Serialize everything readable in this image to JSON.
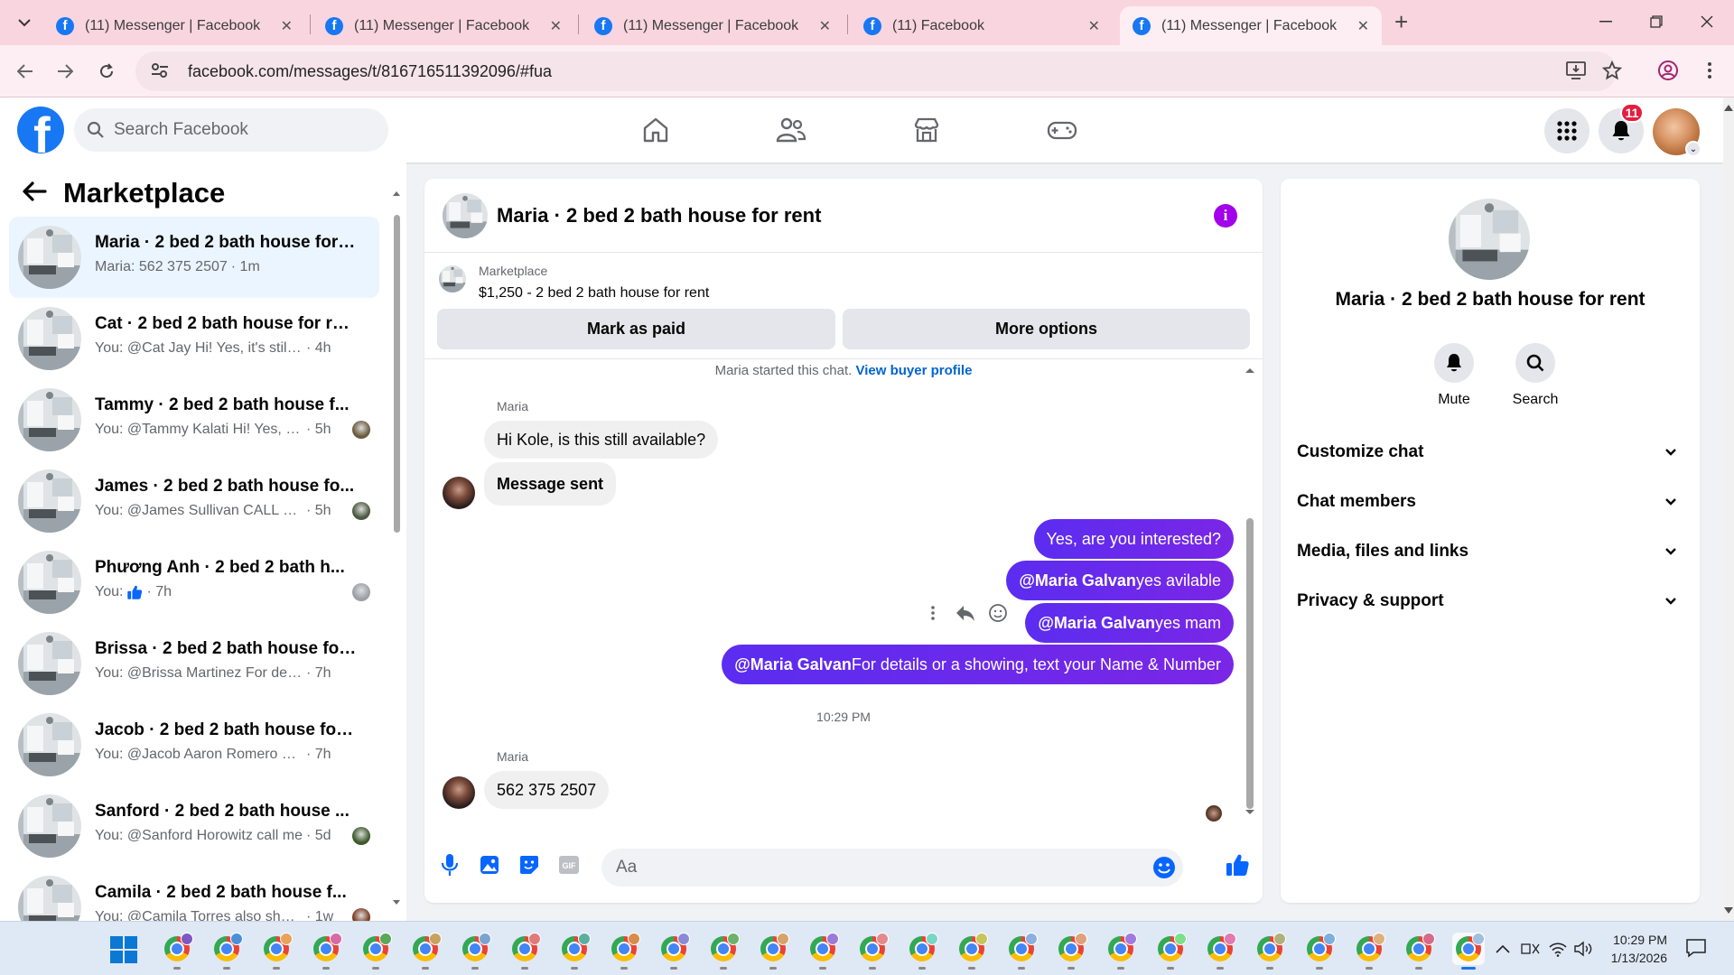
{
  "browser": {
    "tabs": [
      {
        "title": "(11) Messenger | Facebook",
        "active": false
      },
      {
        "title": "(11) Messenger | Facebook",
        "active": false
      },
      {
        "title": "(11) Messenger | Facebook",
        "active": false
      },
      {
        "title": "(11) Facebook",
        "active": false
      },
      {
        "title": "(11) Messenger | Facebook",
        "active": true
      }
    ],
    "url": "facebook.com/messages/t/816716511392096/#fua"
  },
  "header": {
    "search_placeholder": "Search Facebook",
    "notifications_count": "11",
    "nav_icons": [
      "home-icon",
      "friends-icon",
      "marketplace-icon",
      "gaming-icon"
    ]
  },
  "left_pane": {
    "title": "Marketplace",
    "conversations": [
      {
        "name": "Maria · 2 bed 2 bath house for r...",
        "preview": "Maria: 562 375 2507",
        "time": "· 1m",
        "selected": true
      },
      {
        "name": "Cat · 2 bed 2 bath house for rent",
        "preview": "You: @Cat Jay Hi! Yes, it's still availa...",
        "time": "· 4h"
      },
      {
        "name": "Tammy · 2 bed 2 bath house f...",
        "preview": "You: @Tammy Kalati Hi! Yes, it's ...",
        "time": "· 5h"
      },
      {
        "name": "James · 2 bed 2 bath house fo...",
        "preview": "You: @James Sullivan CALL US+...",
        "time": "· 5h"
      },
      {
        "name": "Phương Anh · 2 bed 2 bath h...",
        "preview": "You:",
        "time": "· 7h"
      },
      {
        "name": "Brissa · 2 bed 2 bath house for r...",
        "preview": "You: @Brissa Martinez For details o...",
        "time": "· 7h"
      },
      {
        "name": "Jacob · 2 bed 2 bath house for r...",
        "preview": "You: @Jacob Aaron Romero For det...",
        "time": "· 7h"
      },
      {
        "name": "Sanford · 2 bed 2 bath house ...",
        "preview": "You: @Sanford Horowitz call me",
        "time": "· 5d"
      },
      {
        "name": "Camila · 2 bed 2 bath house f...",
        "preview": "You: @Camila Torres also share...",
        "time": "· 1w"
      }
    ]
  },
  "chat": {
    "title": "Maria · 2 bed 2 bath house for rent",
    "marketplace_label": "Marketplace",
    "listing": "$1,250 - 2 bed 2 bath house for rent",
    "mark_paid": "Mark as paid",
    "more_options": "More options",
    "started_text": "Maria started this chat.",
    "view_profile": "View buyer profile",
    "sender": "Maria",
    "in1": "Hi Kole, is this still available?",
    "in2": "Message sent",
    "out1": "Yes, are you interested?",
    "out2_mention": "@Maria Galvan",
    "out2_text": " yes avilable",
    "out3_mention": "@Maria Galvan",
    "out3_text": " yes mam",
    "out4_mention": "@Maria Galvan",
    "out4_text": " For details or a showing, text your Name & Number",
    "timestamp": "10:29 PM",
    "in3": "562 375 2507",
    "composer_placeholder": "Aa"
  },
  "right_pane": {
    "title": "Maria · 2 bed 2 bath house for rent",
    "mute": "Mute",
    "search": "Search",
    "sections": [
      "Customize chat",
      "Chat members",
      "Media, files and links",
      "Privacy & support"
    ]
  },
  "taskbar": {
    "time": "10:29 PM",
    "date": "1/13/2026",
    "app_count": 27,
    "colors": {
      "accent": "#1877f2",
      "messenger_gradient": "#5b2df0",
      "badge": "#e41e3f"
    }
  }
}
